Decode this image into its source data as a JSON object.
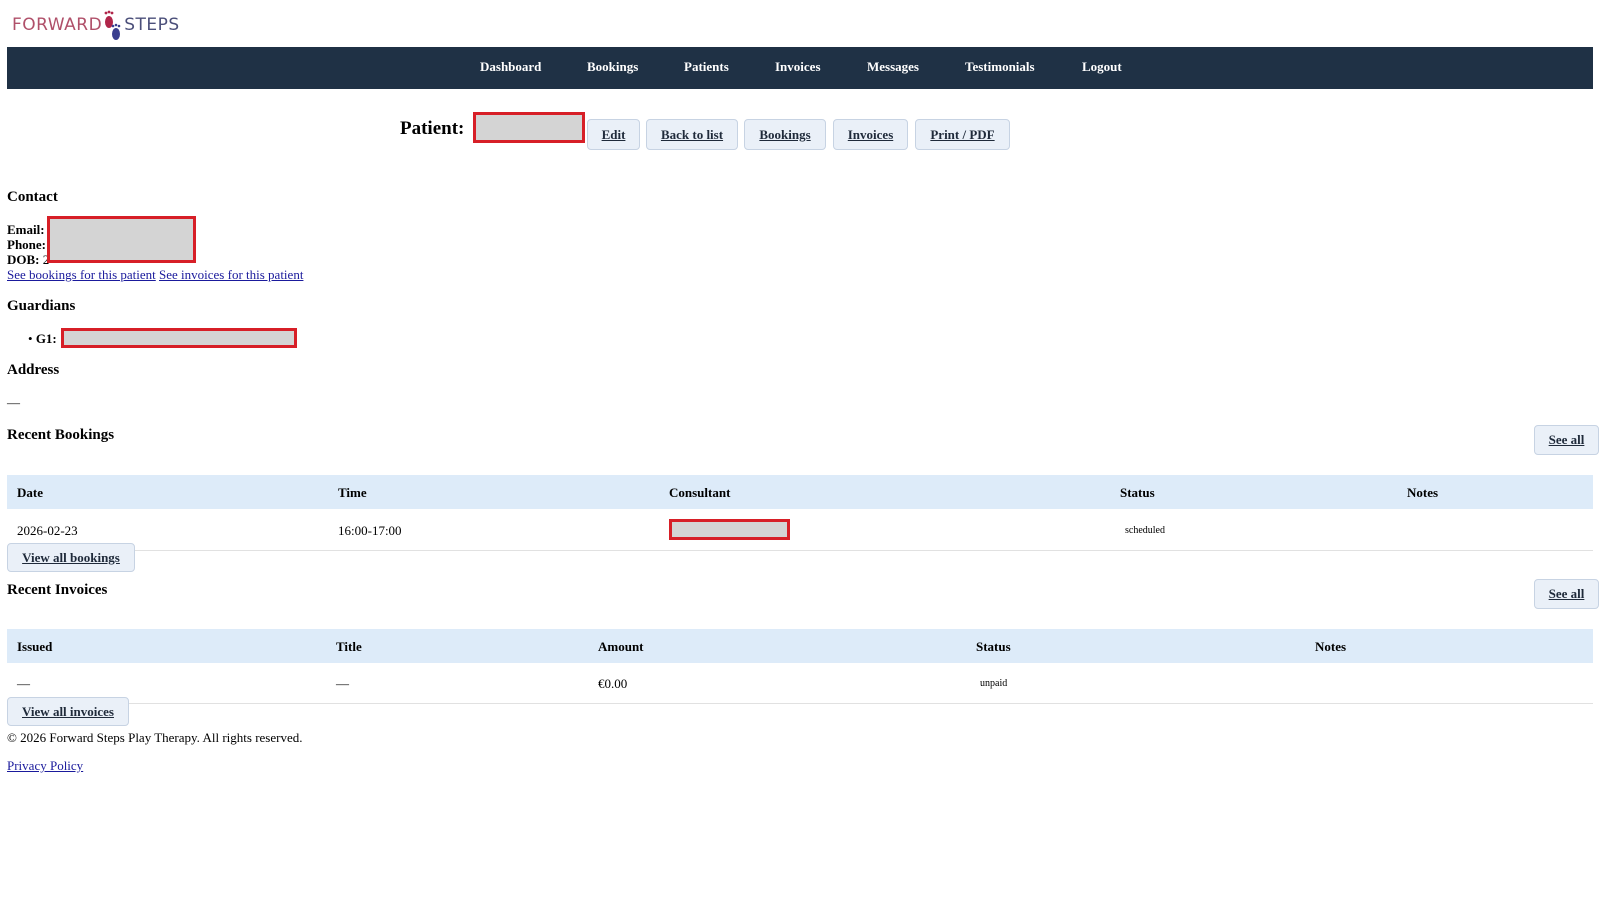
{
  "logo": {
    "word1": "FORWARD",
    "word2": "STEPS"
  },
  "nav": {
    "items": [
      "Dashboard",
      "Bookings",
      "Patients",
      "Invoices",
      "Messages",
      "Testimonials",
      "Logout"
    ]
  },
  "header": {
    "patient_label": "Patient:",
    "buttons": [
      "Edit",
      "Back to list",
      "Bookings",
      "Invoices",
      "Print / PDF"
    ]
  },
  "contact": {
    "title": "Contact",
    "email_label": "Email:",
    "phone_label": "Phone:",
    "dob_label": "DOB:",
    "dob_partial": "2",
    "link_bookings": "See bookings for this patient",
    "link_invoices": "See invoices for this patient"
  },
  "guardians": {
    "title": "Guardians",
    "g1_label": "G1:"
  },
  "address": {
    "title": "Address",
    "value": "—"
  },
  "recent_bookings": {
    "title": "Recent Bookings",
    "see_all": "See all",
    "columns": [
      "Date",
      "Time",
      "Consultant",
      "Status",
      "Notes"
    ],
    "rows": [
      {
        "date": "2026-02-23",
        "time": "16:00-17:00",
        "consultant": "",
        "status": "scheduled",
        "notes": ""
      }
    ],
    "view_all": "View all bookings"
  },
  "recent_invoices": {
    "title": "Recent Invoices",
    "see_all": "See all",
    "columns": [
      "Issued",
      "Title",
      "Amount",
      "Status",
      "Notes"
    ],
    "rows": [
      {
        "issued": "—",
        "title": "—",
        "amount": "€0.00",
        "status": "unpaid",
        "notes": ""
      }
    ],
    "view_all": "View all invoices"
  },
  "footer": {
    "copyright": "© 2026 Forward Steps Play Therapy. All rights reserved.",
    "privacy": "Privacy Policy"
  },
  "colors": {
    "navbar": "#1f3145",
    "redaction_border": "#d71f27",
    "table_header": "#ddebf9",
    "link": "#1a1a9c"
  }
}
